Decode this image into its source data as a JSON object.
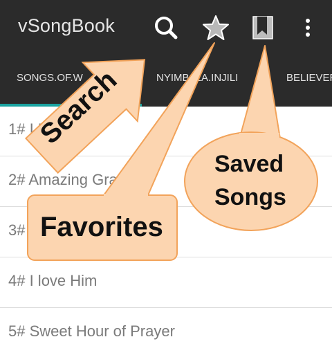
{
  "appbar": {
    "title": "vSongBook",
    "icons": [
      "search-icon",
      "star-icon",
      "bookmark-icon",
      "more-vert-icon"
    ]
  },
  "tabs": [
    {
      "label": "SONGS.OF.W"
    },
    {
      "label": "NYIMB..ZA.INJILI"
    },
    {
      "label": "BELIEVER"
    }
  ],
  "songs": [
    {
      "label": "1# I Believe"
    },
    {
      "label": "2# Amazing Grace"
    },
    {
      "label": "3# Blessed Assurance"
    },
    {
      "label": "4# I love Him"
    },
    {
      "label": "5# Sweet Hour of Prayer"
    }
  ],
  "annotations": {
    "search": "Search",
    "favorites": "Favorites",
    "saved_line1": "Saved",
    "saved_line2": "Songs"
  },
  "colors": {
    "appbar": "#2b2b2b",
    "tab_indicator": "#1aa3a0",
    "callout_fill": "#fcd5b0",
    "callout_stroke": "#f2a35a"
  }
}
